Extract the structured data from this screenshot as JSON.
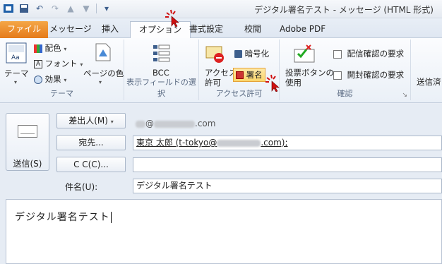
{
  "window": {
    "title": "デジタル署名テスト - メッセージ (HTML 形式)"
  },
  "qat": {
    "icons": [
      "save-icon",
      "undo-icon",
      "redo-icon",
      "up-icon",
      "down-icon",
      "customize-icon"
    ]
  },
  "tabs": [
    {
      "label": "ファイル",
      "state": "file"
    },
    {
      "label": "メッセージ"
    },
    {
      "label": "挿入"
    },
    {
      "label": "オプション",
      "state": "active"
    },
    {
      "label": "書式設定"
    },
    {
      "label": "校閲"
    },
    {
      "label": "Adobe PDF"
    }
  ],
  "ribbon": {
    "theme": {
      "group_label": "テーマ",
      "theme_button": "テーマ",
      "colors": "配色",
      "fonts": "フォント",
      "effects": "効果",
      "page_color": "ページの色"
    },
    "show_fields": {
      "group_label": "表示フィールドの選択",
      "bcc": "BCC"
    },
    "permission": {
      "group_label": "アクセス許可",
      "access": "アクセス\n許可",
      "encrypt": "暗号化",
      "sign": "署名"
    },
    "tracking": {
      "group_label": "確認",
      "voting": "投票ボタンの\n使用",
      "delivery_receipt": "配信確認の要求",
      "read_receipt": "開封確認の要求",
      "more_label": "送信済"
    }
  },
  "compose": {
    "send": "送信(S)",
    "from_button": "差出人(M)",
    "from_suffix": "@",
    "from_domain_end": ".com",
    "to_button": "宛先...",
    "to_value": "東京 太郎 (t-tokyo@",
    "to_value_end": ".com);",
    "cc_button": "C C(C)...",
    "subject_label": "件名(U):",
    "subject_value": "デジタル署名テスト",
    "body_text": "デジタル署名テスト"
  },
  "colors": {
    "file_tab": "#e57b1b",
    "pointer": "#d01010",
    "accent": "#3d5e8c"
  }
}
